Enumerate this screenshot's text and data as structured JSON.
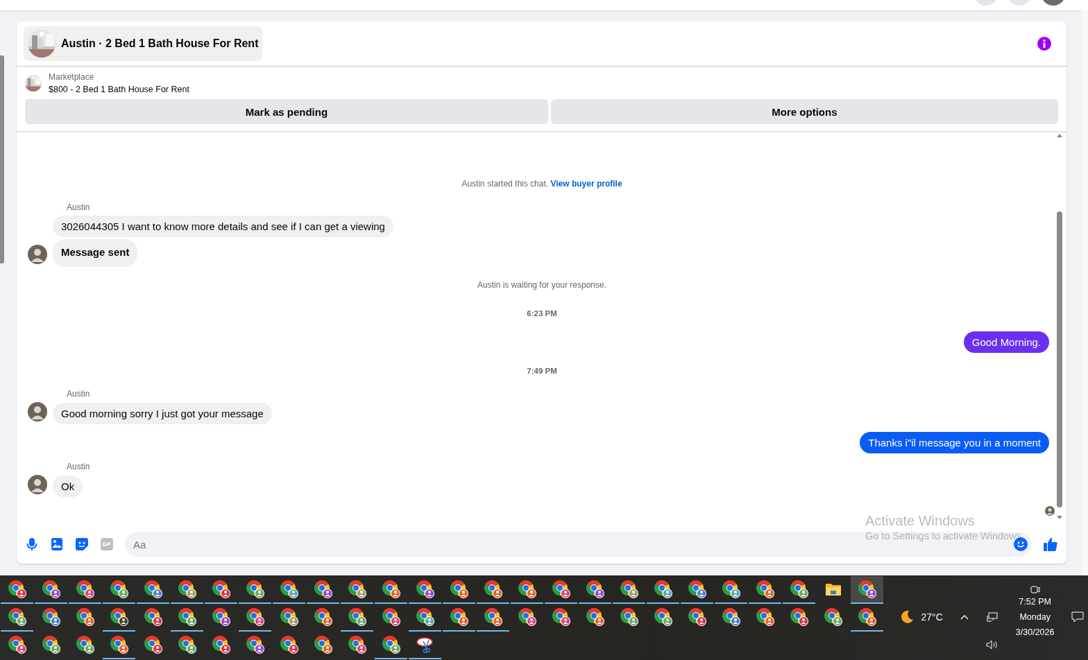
{
  "conversation": {
    "title": "Austin · 2 Bed 1 Bath House For Rent"
  },
  "listing": {
    "source": "Marketplace",
    "summary": "$800 - 2 Bed 1 Bath House For Rent",
    "actions": [
      "Mark as pending",
      "More options"
    ]
  },
  "messages": [
    {
      "kind": "notice",
      "text": "Austin started this chat.",
      "link": "View buyer profile"
    },
    {
      "kind": "incoming",
      "sender": "Austin",
      "bubbles": [
        {
          "text": "3026044305 I want to know more details and see if I can get a viewing",
          "emphasis": false
        },
        {
          "text": "Message sent",
          "emphasis": true
        }
      ]
    },
    {
      "kind": "notice",
      "text": "Austin is waiting for your response."
    },
    {
      "kind": "time",
      "text": "6:23 PM"
    },
    {
      "kind": "outgoing",
      "color": "#6b2ff0",
      "bubbles": [
        {
          "text": "Good Morning.",
          "emphasis": false
        }
      ]
    },
    {
      "kind": "time",
      "text": "7:49 PM"
    },
    {
      "kind": "incoming",
      "sender": "Austin",
      "bubbles": [
        {
          "text": "Good morning sorry I just got your message",
          "emphasis": false
        }
      ]
    },
    {
      "kind": "outgoing",
      "color": "#0a5cf5",
      "bubbles": [
        {
          "text": "Thanks i\"il message you in a moment",
          "emphasis": false
        }
      ]
    },
    {
      "kind": "incoming",
      "sender": "Austin",
      "bubbles": [
        {
          "text": "Ok",
          "emphasis": false
        }
      ]
    }
  ],
  "read_receipt": true,
  "composer": {
    "placeholder": "Aa"
  },
  "activation_notice": {
    "title": "Activate Windows",
    "text": "Go to Settings to activate Windows"
  },
  "taskbar": {
    "apps": [
      {
        "kind": "chrome",
        "color": "#e0304a",
        "running": true,
        "selected": false
      },
      {
        "kind": "chrome",
        "color": "#9b45d6",
        "running": true,
        "selected": false
      },
      {
        "kind": "chrome",
        "color": "#e0407a",
        "running": true,
        "selected": false
      },
      {
        "kind": "chrome",
        "color": "#6aa86a",
        "running": true,
        "selected": false
      },
      {
        "kind": "chrome",
        "color": "#4a7fd8",
        "running": true,
        "selected": false
      },
      {
        "kind": "chrome",
        "color": "#a39a6a",
        "running": true,
        "selected": false
      },
      {
        "kind": "chrome",
        "color": "#e0304a",
        "running": true,
        "selected": false
      },
      {
        "kind": "chrome",
        "color": "#6aa86a",
        "running": true,
        "selected": false
      },
      {
        "kind": "chrome",
        "color": "#5aa8b8",
        "running": true,
        "selected": false
      },
      {
        "kind": "chrome",
        "color": "#9b45d6",
        "running": true,
        "selected": false
      },
      {
        "kind": "chrome",
        "color": "#a39a6a",
        "running": true,
        "selected": false
      },
      {
        "kind": "chrome",
        "color": "#e8602c",
        "running": true,
        "selected": false
      },
      {
        "kind": "chrome",
        "color": "#9b45d6",
        "running": true,
        "selected": false
      },
      {
        "kind": "chrome",
        "color": "#e8602c",
        "running": true,
        "selected": false
      },
      {
        "kind": "chrome",
        "color": "#e8602c",
        "running": true,
        "selected": false
      },
      {
        "kind": "chrome",
        "color": "#e8602c",
        "running": true,
        "selected": false
      },
      {
        "kind": "chrome",
        "color": "#e0407a",
        "running": true,
        "selected": false
      },
      {
        "kind": "chrome",
        "color": "#9b45d6",
        "running": true,
        "selected": false
      },
      {
        "kind": "chrome",
        "color": "#a39a6a",
        "running": true,
        "selected": false
      },
      {
        "kind": "chrome",
        "color": "#5aa8b8",
        "running": true,
        "selected": false
      },
      {
        "kind": "chrome",
        "color": "#4a7fd8",
        "running": true,
        "selected": false
      },
      {
        "kind": "chrome",
        "color": "#5aa8b8",
        "running": true,
        "selected": false
      },
      {
        "kind": "chrome",
        "color": "#e8602c",
        "running": true,
        "selected": false
      },
      {
        "kind": "chrome",
        "color": "#6aa86a",
        "running": true,
        "selected": false
      },
      {
        "kind": "folder",
        "running": false,
        "selected": false
      },
      {
        "kind": "chrome",
        "color": "#9b45d6",
        "running": true,
        "selected": true
      },
      {
        "kind": "chrome",
        "color": "#6aa86a",
        "running": true,
        "selected": false
      },
      {
        "kind": "chrome",
        "color": "#4a7fd8",
        "running": false,
        "selected": false
      },
      {
        "kind": "chrome",
        "color": "#e8602c",
        "running": false,
        "selected": false
      },
      {
        "kind": "chrome",
        "color": "#4a3a2a",
        "running": true,
        "selected": false
      },
      {
        "kind": "chrome",
        "color": "#e0304a",
        "running": false,
        "selected": false
      },
      {
        "kind": "chrome",
        "color": "#6aa86a",
        "running": true,
        "selected": false
      },
      {
        "kind": "chrome",
        "color": "#9b45d6",
        "running": false,
        "selected": false
      },
      {
        "kind": "chrome",
        "color": "#e0407a",
        "running": true,
        "selected": false
      },
      {
        "kind": "chrome",
        "color": "#a39a6a",
        "running": false,
        "selected": false
      },
      {
        "kind": "chrome",
        "color": "#e8602c",
        "running": false,
        "selected": false
      },
      {
        "kind": "chrome",
        "color": "#6aa86a",
        "running": true,
        "selected": false
      },
      {
        "kind": "chrome",
        "color": "#e0407a",
        "running": false,
        "selected": false
      },
      {
        "kind": "chrome",
        "color": "#5aa8b8",
        "running": true,
        "selected": false
      },
      {
        "kind": "chrome",
        "color": "#e8602c",
        "running": true,
        "selected": false
      },
      {
        "kind": "chrome",
        "color": "#e8602c",
        "running": true,
        "selected": false
      },
      {
        "kind": "chrome",
        "color": "#e0407a",
        "running": false,
        "selected": false
      },
      {
        "kind": "chrome",
        "color": "#e0407a",
        "running": false,
        "selected": false
      },
      {
        "kind": "chrome",
        "color": "#e8602c",
        "running": false,
        "selected": false
      },
      {
        "kind": "chrome",
        "color": "#6aa86a",
        "running": false,
        "selected": false
      },
      {
        "kind": "chrome",
        "color": "#6aa86a",
        "running": false,
        "selected": false
      },
      {
        "kind": "chrome",
        "color": "#e0304a",
        "running": false,
        "selected": false
      },
      {
        "kind": "chrome",
        "color": "#4a7fd8",
        "running": false,
        "selected": false
      },
      {
        "kind": "chrome",
        "color": "#e8602c",
        "running": false,
        "selected": false
      },
      {
        "kind": "chrome",
        "color": "#e0304a",
        "running": false,
        "selected": false
      },
      {
        "kind": "chrome",
        "color": "#6aa86a",
        "running": false,
        "selected": false
      },
      {
        "kind": "chrome",
        "color": "#e8602c",
        "running": true,
        "selected": false
      },
      {
        "kind": "chrome",
        "color": "#e0407a",
        "running": false,
        "selected": false
      },
      {
        "kind": "chrome",
        "color": "#6aa86a",
        "running": false,
        "selected": false
      },
      {
        "kind": "chrome",
        "color": "#6aa86a",
        "running": false,
        "selected": false
      },
      {
        "kind": "chrome",
        "color": "#e8602c",
        "running": true,
        "selected": false
      },
      {
        "kind": "chrome",
        "color": "#e0304a",
        "running": false,
        "selected": false
      },
      {
        "kind": "chrome",
        "color": "#6aa86a",
        "running": false,
        "selected": false
      },
      {
        "kind": "chrome",
        "color": "#e0304a",
        "running": false,
        "selected": false
      },
      {
        "kind": "chrome",
        "color": "#9b45d6",
        "running": false,
        "selected": false
      },
      {
        "kind": "chrome",
        "color": "#e0304a",
        "running": false,
        "selected": false
      },
      {
        "kind": "chrome",
        "color": "#e8602c",
        "running": false,
        "selected": false
      },
      {
        "kind": "chrome",
        "color": "#e0407a",
        "running": false,
        "selected": false
      },
      {
        "kind": "chrome",
        "color": "#6aa86a",
        "running": true,
        "selected": false
      },
      {
        "kind": "snip",
        "running": true,
        "selected": false
      }
    ]
  },
  "tray": {
    "temperature": "27°C",
    "time": "7:52 PM",
    "day": "Monday",
    "date": "3/30/2026"
  }
}
